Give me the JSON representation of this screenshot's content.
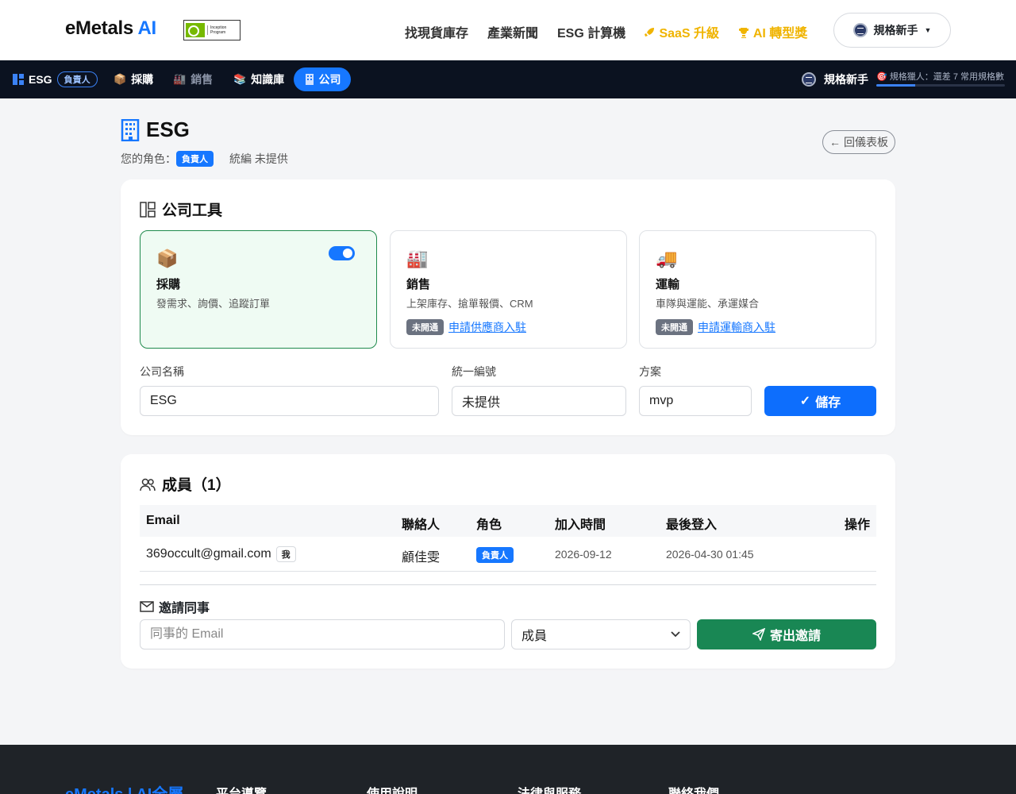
{
  "header": {
    "brand_main": "eMetals",
    "brand_ai": "AI",
    "partner_badge": "Inception Program",
    "nav": [
      "找現貨庫存",
      "產業新聞",
      "ESG 計算機"
    ],
    "promo_saas": "SaaS 升級",
    "promo_ai": "AI 轉型獎",
    "user_label": "規格新手"
  },
  "subnav": {
    "company": "ESG",
    "role_chip": "負責人",
    "items": [
      "採購",
      "銷售",
      "知識庫",
      "公司"
    ],
    "user_level": "規格新手",
    "progress_text": "規格獵人：還差 7 常用規格數",
    "progress_fraction": 0.3
  },
  "page": {
    "title": "ESG",
    "role_prefix": "您的角色：",
    "role_badge": "負責人",
    "tax_id_text": "統編 未提供",
    "back_label": "回儀表板"
  },
  "tools_card": {
    "title": "公司工具",
    "tools": [
      {
        "emoji": "📦",
        "name": "採購",
        "desc": "發需求、詢價、追蹤訂單",
        "enabled": true
      },
      {
        "emoji": "🏭",
        "name": "銷售",
        "desc": "上架庫存、搶單報價、CRM",
        "status": "未開通",
        "link": "申請供應商入駐"
      },
      {
        "emoji": "🚚",
        "name": "運輸",
        "desc": "車隊與運能、承運媒合",
        "status": "未開通",
        "link": "申請運輸商入駐"
      }
    ],
    "fields": {
      "name_label": "公司名稱",
      "name_value": "ESG",
      "taxid_label": "統一編號",
      "taxid_value": "未提供",
      "plan_label": "方案",
      "plan_value": "mvp"
    },
    "save_label": "儲存"
  },
  "members_card": {
    "title": "成員（1）",
    "columns": [
      "Email",
      "聯絡人",
      "角色",
      "加入時間",
      "最後登入",
      "操作"
    ],
    "rows": [
      {
        "email": "369occult@gmail.com",
        "me": "我",
        "contact": "顧佳雯",
        "role": "負責人",
        "joined": "2026-09-12",
        "last_login": "2026-04-30 01:45"
      }
    ],
    "invite_title": "邀請同事",
    "invite_placeholder": "同事的 Email",
    "invite_role": "成員",
    "invite_button": "寄出邀請"
  },
  "footer": {
    "brand": "eMetals | AI全屬",
    "cols": [
      "平台導覽",
      "使用說明",
      "法律與服務",
      "聯絡我們"
    ]
  },
  "colors": {
    "accent": "#1677ff",
    "success": "#198754",
    "gold": "#f0b400",
    "dark_nav": "#0b1220"
  }
}
